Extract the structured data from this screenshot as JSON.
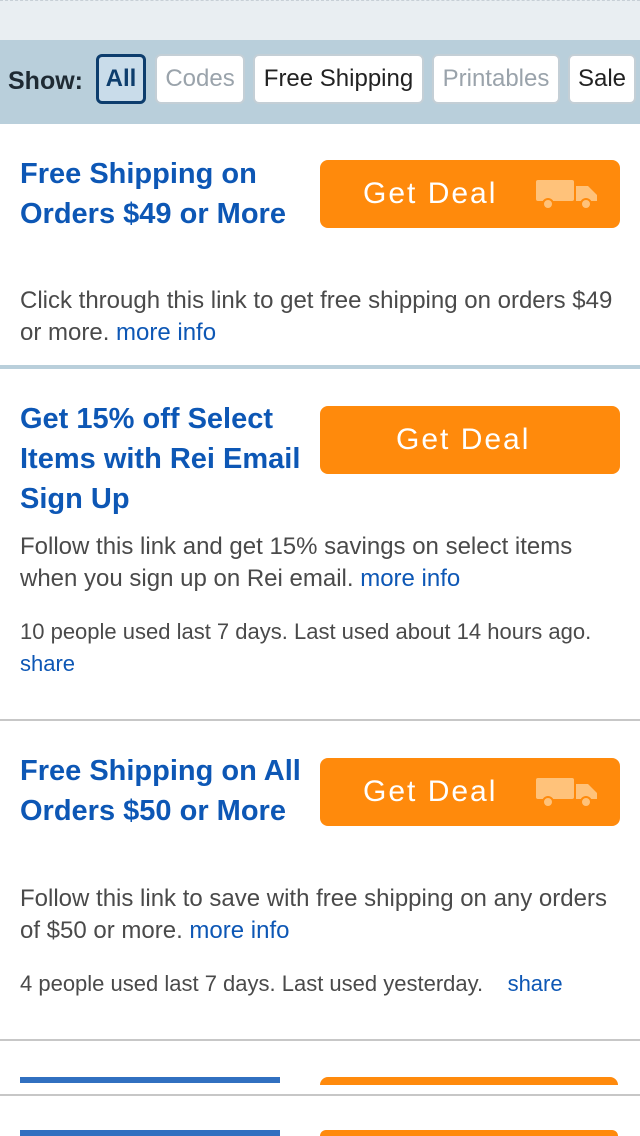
{
  "filter": {
    "show_label": "Show:",
    "options": [
      {
        "label": "All",
        "active": true
      },
      {
        "label": "Codes",
        "active": false
      },
      {
        "label": "Free Shipping",
        "active": false
      },
      {
        "label": "Printables",
        "active": false
      },
      {
        "label": "Sale",
        "active": false
      }
    ]
  },
  "deals": [
    {
      "title": "Free Shipping on Orders $49 or More",
      "button_label": "Get Deal",
      "button_icon": "truck-icon",
      "description": "Click through this link to get free shipping on orders $49 or more.",
      "more_info": "more info"
    },
    {
      "title": "Get 15% off Select Items with Rei Email Sign Up",
      "button_label": "Get Deal",
      "description": "Follow this link and get 15% savings on select items when you sign up on Rei email.",
      "more_info": "more info",
      "stats": "10 people used last 7 days. Last used about 14 hours ago.",
      "share": "share"
    },
    {
      "title": "Free Shipping on All Orders $50 or More",
      "button_label": "Get Deal",
      "button_icon": "truck-icon",
      "description": "Follow this link to save with free shipping on any orders of $50 or more.",
      "more_info": "more info",
      "stats": "4 people used last 7 days. Last used yesterday.",
      "share": "share"
    }
  ],
  "colors": {
    "accent_orange": "#ff8a0c",
    "link_blue": "#0d57b5",
    "filter_bar": "#b9cfdb",
    "active_border": "#0d3d6d"
  }
}
